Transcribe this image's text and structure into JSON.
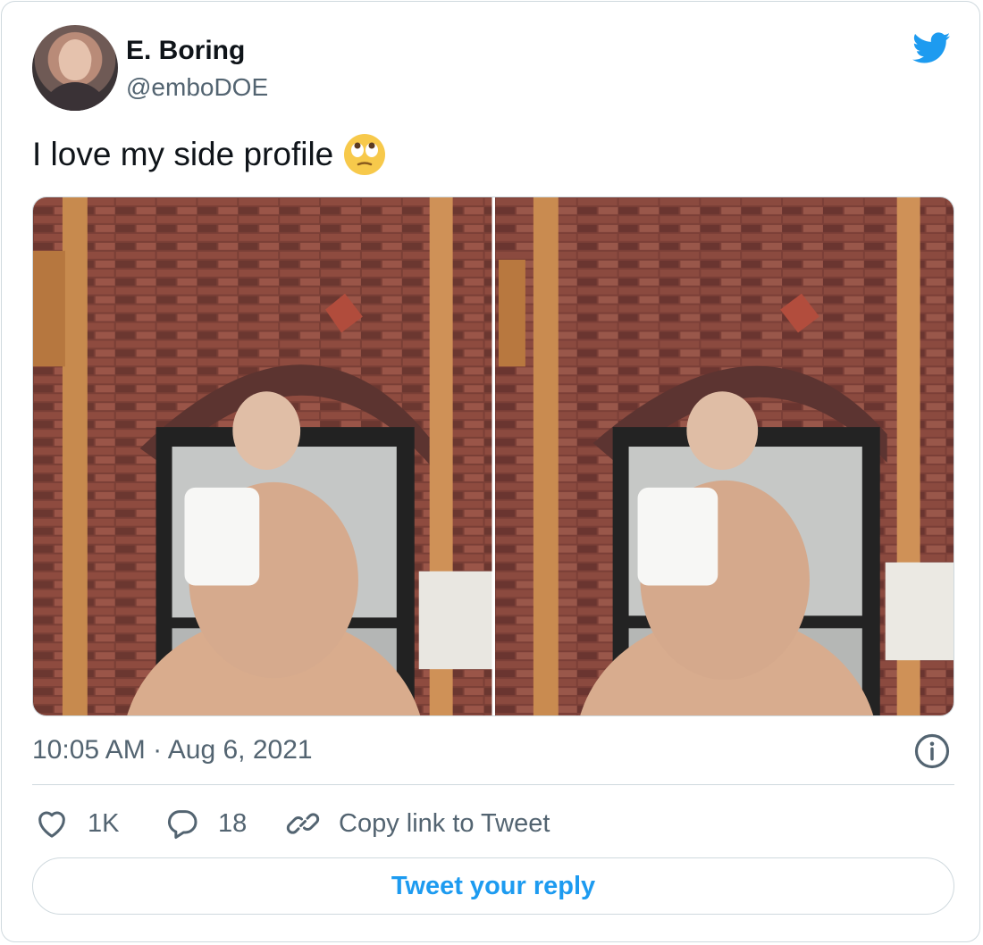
{
  "tweet": {
    "author": {
      "display_name": "E. Boring",
      "handle": "@emboDOE"
    },
    "text": "I love my side profile",
    "emoji": "rolling-eyes-emoji",
    "timestamp": "10:05 AM · Aug 6, 2021",
    "actions": {
      "likes": "1K",
      "replies": "18",
      "copy_link": "Copy link to Tweet"
    },
    "reply_button": "Tweet your reply"
  },
  "colors": {
    "text": "#0f1419",
    "secondary": "#536471",
    "accent": "#1d9bf0",
    "border": "#cfd9de"
  },
  "icons": {
    "brand": "twitter-bird-icon",
    "info": "info-icon",
    "like": "heart-icon",
    "reply": "speech-bubble-icon",
    "copy_link": "link-icon"
  }
}
